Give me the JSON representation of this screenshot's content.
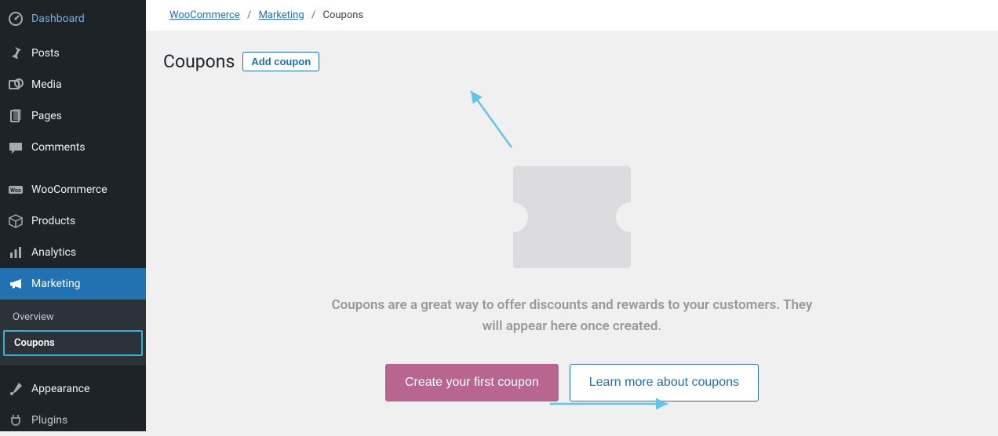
{
  "sidebar": {
    "items": [
      {
        "label": "Dashboard",
        "icon": "dashboard"
      },
      {
        "label": "Posts",
        "icon": "pin"
      },
      {
        "label": "Media",
        "icon": "media"
      },
      {
        "label": "Pages",
        "icon": "pages"
      },
      {
        "label": "Comments",
        "icon": "comment"
      },
      {
        "label": "WooCommerce",
        "icon": "woo"
      },
      {
        "label": "Products",
        "icon": "products"
      },
      {
        "label": "Analytics",
        "icon": "analytics"
      },
      {
        "label": "Marketing",
        "icon": "marketing",
        "active": true
      },
      {
        "label": "Appearance",
        "icon": "appearance"
      },
      {
        "label": "Plugins",
        "icon": "plugins"
      }
    ],
    "submenu": {
      "items": [
        {
          "label": "Overview"
        },
        {
          "label": "Coupons",
          "current": true
        }
      ]
    }
  },
  "breadcrumb": {
    "items": [
      {
        "label": "WooCommerce",
        "link": true
      },
      {
        "label": "Marketing",
        "link": true
      },
      {
        "label": "Coupons",
        "link": false
      }
    ]
  },
  "page": {
    "title": "Coupons",
    "add_button": "Add coupon"
  },
  "empty_state": {
    "message": "Coupons are a great way to offer discounts and rewards to your customers. They will appear here once created.",
    "primary_cta": "Create your first coupon",
    "secondary_cta": "Learn more about coupons"
  }
}
